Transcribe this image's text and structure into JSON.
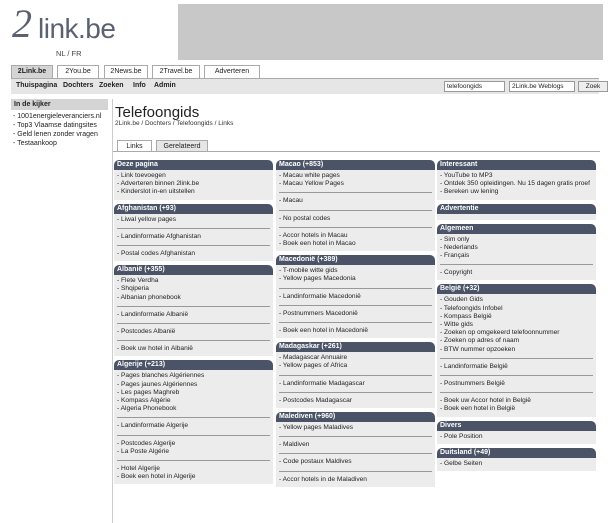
{
  "logo": {
    "two": "2",
    "link": "link.be"
  },
  "lang": "NL / FR",
  "tabs": [
    "2Link.be",
    "2You.be",
    "2News.be",
    "2Travel.be",
    "Adverteren"
  ],
  "nav": [
    "Thuispagina",
    "Dochters",
    "Zoeken",
    "Info",
    "Admin"
  ],
  "search": {
    "value": "telefoongids",
    "select": "2Link.be Weblogs",
    "button": "Zoek"
  },
  "sidebar": {
    "title": "In de kijker",
    "items": [
      "- 1001energieleveranciers.nl",
      "- Top3 Vlaamse datingsites",
      "- Geld lenen zonder vragen",
      "- Testaankoop"
    ]
  },
  "page": {
    "title": "Telefoongids",
    "breadcrumb": "2Link.be / Dochters / Telefoongids / Links",
    "tabs": [
      "Links",
      "Gerelateerd"
    ]
  },
  "columns": [
    [
      {
        "title": "Deze pagina",
        "groups": [
          [
            "- Link toevoegen",
            "- Adverteren binnen 2link.be",
            "- Kinderslot in-en uitstellen"
          ]
        ]
      },
      {
        "title": "Afghanistan (+93)",
        "groups": [
          [
            "- Liwal yellow pages"
          ],
          [
            "- Landinformatie Afghanistan"
          ],
          [
            "- Postal codes Afghanistan"
          ]
        ]
      },
      {
        "title": "Albanië (+355)",
        "groups": [
          [
            "- Flete Verdha",
            "- Shqiperia",
            "- Albanian phonebook"
          ],
          [
            "- Landinformatie Albanië"
          ],
          [
            "- Postcodes Albanië"
          ],
          [
            "- Boek uw hotel in Albanië"
          ]
        ]
      },
      {
        "title": "Algerije (+213)",
        "groups": [
          [
            "- Pages blanches Algériennes",
            "- Pages jaunes Algériennes",
            "- Les pages Maghreb",
            "- Kompass Algérie",
            "- Algeria Phonebook"
          ],
          [
            "- Landinformatie Algerije"
          ],
          [
            "- Postcodes Algerije",
            "- La Poste Algérie"
          ],
          [
            "- Hotel Algerije",
            "- Boek een hotel in Algerije"
          ]
        ]
      }
    ],
    [
      {
        "title": "Macao (+853)",
        "groups": [
          [
            "- Macau white pages",
            "- Macau Yellow Pages"
          ],
          [
            "- Macau"
          ],
          [
            "- No postal codes"
          ],
          [
            "- Accor hotels in Macau",
            "- Boek een hotel in Macao"
          ]
        ]
      },
      {
        "title": "Macedonië (+389)",
        "groups": [
          [
            "- T-mobile witte gids",
            "- Yellow pages Macedonia"
          ],
          [
            "- Landinformatie Macedonië"
          ],
          [
            "- Postnummers Macedonië"
          ],
          [
            "- Boek een hotel in Macedonië"
          ]
        ]
      },
      {
        "title": "Madagaskar (+261)",
        "groups": [
          [
            "- Madagascar Annuaire",
            "- Yellow pages of Africa"
          ],
          [
            "- Landinformatie Madagascar"
          ],
          [
            "- Postcodes Madagascar"
          ]
        ]
      },
      {
        "title": "Malediven (+960)",
        "groups": [
          [
            "- Yellow pages Maladives"
          ],
          [
            "- Maldiven"
          ],
          [
            "- Code postaux Maldives"
          ],
          [
            "- Accor hotels in de Maladiven"
          ]
        ]
      }
    ],
    [
      {
        "title": "Interessant",
        "groups": [
          [
            "- YouTube to MP3",
            "- Ontdek 350 opleidingen. Nu 15 dagen gratis proef",
            "- Bereken uw lening"
          ]
        ]
      },
      {
        "title": "Advertentie",
        "groups": []
      },
      {
        "title": "Algemeen",
        "groups": [
          [
            "- Sim only",
            "- Nederlands",
            "- Français"
          ],
          [
            "- Copyright"
          ]
        ]
      },
      {
        "title": "België (+32)",
        "groups": [
          [
            "- Gouden Gids",
            "- Telefoongids Infobel",
            "- Kompass België",
            "- Witte gids",
            "- Zoeken op omgekeerd telefoonnummer",
            "- Zoeken op adres of naam",
            "- BTW nummer opzoeken"
          ],
          [
            "- Landinformatie België"
          ],
          [
            "- Postnummers België"
          ],
          [
            "- Boek uw Accor hotel in België",
            "- Boek een hotel in België"
          ]
        ]
      },
      {
        "title": "Divers",
        "groups": [
          [
            "- Pole Position"
          ]
        ]
      },
      {
        "title": "Duitsland (+49)",
        "groups": [
          [
            "- Gelbe Seiten"
          ]
        ]
      }
    ]
  ]
}
